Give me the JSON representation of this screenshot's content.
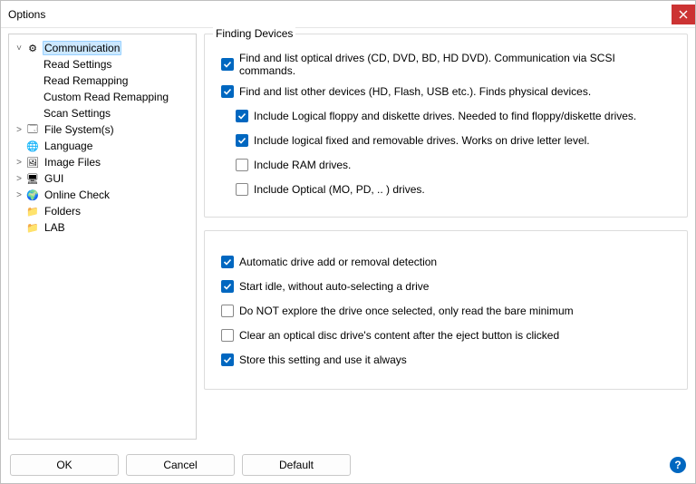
{
  "window": {
    "title": "Options"
  },
  "tree": {
    "nodes": [
      {
        "label": "Communication",
        "depth": 0,
        "expander": "v",
        "icon": "settings-icon",
        "selected": true
      },
      {
        "label": "Read Settings",
        "depth": 1,
        "expander": "",
        "icon": ""
      },
      {
        "label": "Read Remapping",
        "depth": 1,
        "expander": "",
        "icon": ""
      },
      {
        "label": "Custom Read Remapping",
        "depth": 1,
        "expander": "",
        "icon": ""
      },
      {
        "label": "Scan Settings",
        "depth": 1,
        "expander": "",
        "icon": ""
      },
      {
        "label": "File System(s)",
        "depth": 0,
        "expander": ">",
        "icon": "filesystem-icon"
      },
      {
        "label": "Language",
        "depth": 0,
        "expander": "",
        "icon": "language-icon"
      },
      {
        "label": "Image Files",
        "depth": 0,
        "expander": ">",
        "icon": "image-icon"
      },
      {
        "label": "GUI",
        "depth": 0,
        "expander": ">",
        "icon": "gui-icon"
      },
      {
        "label": "Online Check",
        "depth": 0,
        "expander": ">",
        "icon": "online-icon"
      },
      {
        "label": "Folders",
        "depth": 0,
        "expander": "",
        "icon": "folder-icon"
      },
      {
        "label": "LAB",
        "depth": 0,
        "expander": "",
        "icon": "folder-icon"
      }
    ]
  },
  "finding": {
    "legend": "Finding Devices",
    "options": [
      {
        "label": "Find and list optical drives (CD, DVD, BD, HD DVD).  Communication via SCSI commands.",
        "checked": true,
        "indent": 0
      },
      {
        "label": "Find and list other devices (HD, Flash, USB etc.).  Finds physical devices.",
        "checked": true,
        "indent": 0
      },
      {
        "label": "Include Logical floppy and diskette drives.  Needed to find floppy/diskette drives.",
        "checked": true,
        "indent": 1
      },
      {
        "label": "Include logical fixed and removable drives.  Works on drive letter level.",
        "checked": true,
        "indent": 1
      },
      {
        "label": "Include RAM drives.",
        "checked": false,
        "indent": 1
      },
      {
        "label": "Include Optical (MO, PD, .. ) drives.",
        "checked": false,
        "indent": 1
      }
    ]
  },
  "misc": {
    "options": [
      {
        "label": "Automatic drive add or removal detection",
        "checked": true
      },
      {
        "label": "Start idle, without auto-selecting a drive",
        "checked": true
      },
      {
        "label": "Do NOT explore the drive once selected, only read the bare minimum",
        "checked": false
      },
      {
        "label": "Clear an optical disc drive's content after the eject button is clicked",
        "checked": false
      },
      {
        "label": "Store this setting and use it always",
        "checked": true
      }
    ]
  },
  "buttons": {
    "ok": "OK",
    "cancel": "Cancel",
    "default": "Default"
  },
  "icons": {
    "settings-icon": "⚙",
    "filesystem-icon": "🗔",
    "language-icon": "🌐",
    "image-icon": "🖼",
    "gui-icon": "🖥",
    "online-icon": "🌍",
    "folder-icon": "📁"
  }
}
